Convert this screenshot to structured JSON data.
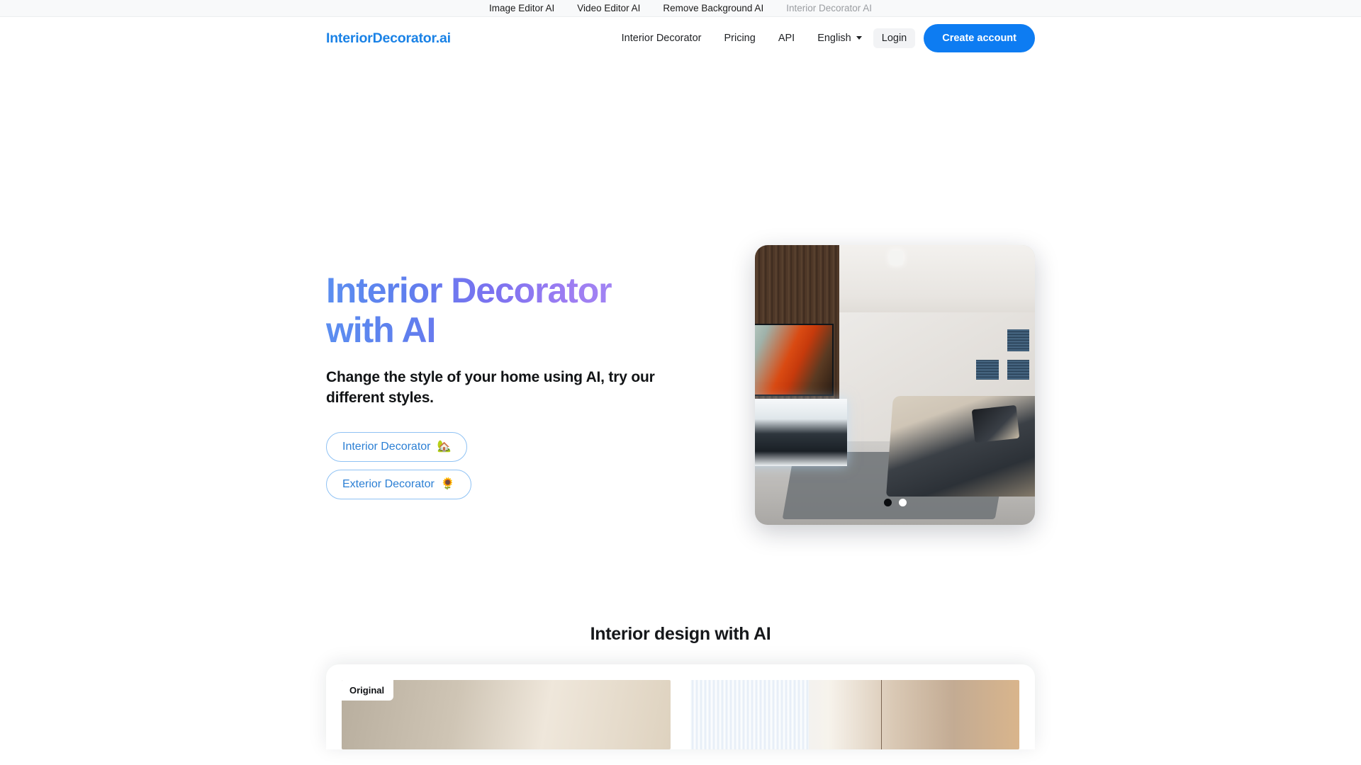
{
  "topbar": {
    "links": [
      {
        "label": "Image Editor AI",
        "active": false
      },
      {
        "label": "Video Editor AI",
        "active": false
      },
      {
        "label": "Remove Background AI",
        "active": false
      },
      {
        "label": "Interior Decorator AI",
        "active": true
      }
    ]
  },
  "navbar": {
    "brand": "InteriorDecorator.ai",
    "links": [
      {
        "label": "Interior Decorator"
      },
      {
        "label": "Pricing"
      },
      {
        "label": "API"
      }
    ],
    "language": "English",
    "login_label": "Login",
    "create_account_label": "Create account",
    "accent_color": "#0d7cf2",
    "brand_color": "#1a82e6"
  },
  "hero": {
    "title_line1": "Interior Decorator",
    "title_line2": "with AI",
    "subtitle": "Change the style of your home using AI, try our different styles.",
    "gradient_start": "#5b8ef0",
    "gradient_end": "#a184f3",
    "buttons": [
      {
        "label": "Interior Decorator",
        "emoji": "🏡"
      },
      {
        "label": "Exterior Decorator",
        "emoji": "🌻"
      }
    ],
    "carousel": {
      "slides": 2,
      "active_index": 1
    }
  },
  "section": {
    "title": "Interior design with AI",
    "original_badge": "Original"
  }
}
